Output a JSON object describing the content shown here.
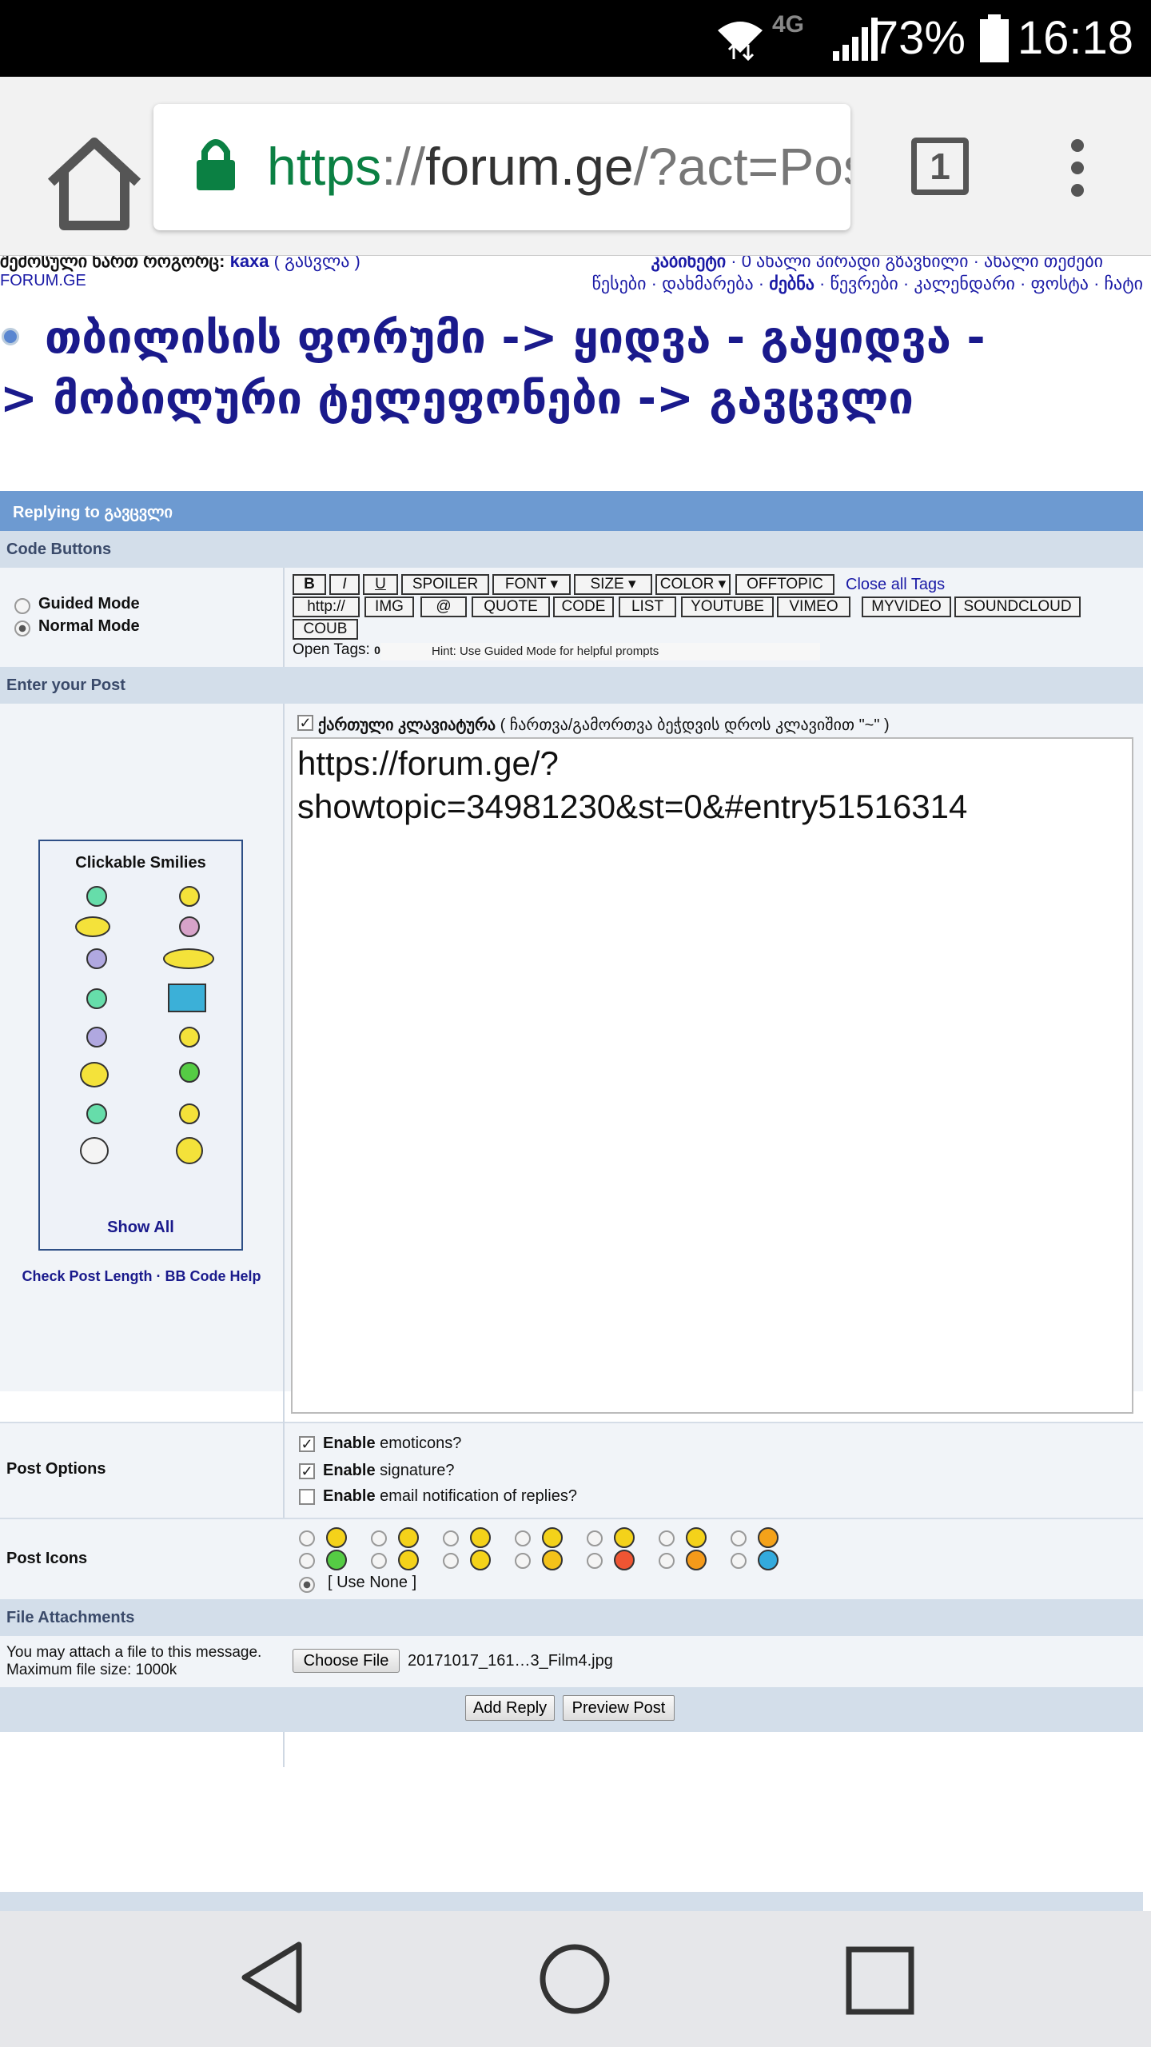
{
  "status_bar": {
    "battery": "73%",
    "time": "16:18"
  },
  "browser": {
    "url_scheme": "https",
    "url_sep": "://",
    "url_host": "forum.ge",
    "url_path": "/?act=Post",
    "tab_count": "1"
  },
  "forum": {
    "logged_in_label": "შემოსული ხართ როგორც:",
    "username": "kaxa",
    "logout": "( გასვლა )",
    "site_name": "FORUM.GE",
    "top_links": [
      "კაბინეტი",
      "0 ახალი პირადი გზავნილი",
      "ახალი თემები"
    ],
    "nav_links": [
      "წესები",
      "დახმარება",
      "ძებნა",
      "წევრები",
      "კალენდარი",
      "ფოსტა",
      "ჩატი"
    ],
    "title_line1": "თბილისის ფორუმი -> ყიდვა - გაყიდვა -",
    "title_line2": "> მობილური ტელეფონები -> გავცვლი"
  },
  "form": {
    "replying_header": "Replying to გავცვლი",
    "code_buttons_label": "Code Buttons",
    "guided_mode": "Guided Mode",
    "normal_mode": "Normal Mode",
    "buttons_row1": [
      "B",
      "I",
      "U",
      "SPOILER",
      "FONT ▾",
      "SIZE ▾",
      "COLOR ▾",
      "OFFTOPIC"
    ],
    "close_all_tags": "Close all Tags",
    "buttons_row2": [
      "http://",
      "IMG",
      "@",
      "QUOTE",
      "CODE",
      "LIST",
      "YOUTUBE",
      "VIMEO",
      "MYVIDEO",
      "SOUNDCLOUD"
    ],
    "buttons_row3": [
      "COUB"
    ],
    "open_tags": "Open Tags:",
    "open_tags_count": "0",
    "hint": "Hint: Use Guided Mode for helpful prompts",
    "enter_post_label": "Enter your Post",
    "georgian_keyboard": "ქართული კლავიატურა",
    "georgian_keyboard_hint": "( ჩართვა/გამორთვა ბეჭდვის დროს კლავიშით \"~\" )",
    "post_text_line1": "https://forum.ge/?",
    "post_text_line2": "showtopic=34981230&st=0&#entry51516314",
    "smilies_title": "Clickable Smilies",
    "show_all": "Show All",
    "check_length": "Check Post Length",
    "bbcode_help": "BB Code Help",
    "post_options_label": "Post Options",
    "opt_emoticons_bold": "Enable",
    "opt_emoticons": "emoticons?",
    "opt_signature_bold": "Enable",
    "opt_signature": "signature?",
    "opt_email_bold": "Enable",
    "opt_email": "email notification of replies?",
    "post_icons_label": "Post Icons",
    "use_none": "[ Use None ]",
    "file_attach_label": "File Attachments",
    "attach_note_line1": "You may attach a file to this message.",
    "attach_note_line2": "Maximum file size: 1000k",
    "choose_file": "Choose File",
    "file_name": "20171017_161…3_Film4.jpg",
    "add_reply": "Add Reply",
    "preview_post": "Preview Post"
  },
  "colors": {
    "accent_blue": "#6d9ad1",
    "header_light": "#d3deea",
    "link": "#1a1aa6",
    "url_green": "#0b8043"
  }
}
